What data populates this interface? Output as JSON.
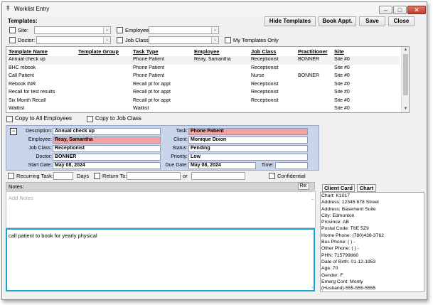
{
  "window": {
    "title": "Worklist Entry"
  },
  "toolbar": {
    "hide_templates": "Hide Templates",
    "book_appt": "Book Appt.",
    "save": "Save",
    "close": "Close"
  },
  "templates": {
    "heading": "Templates:",
    "site_label": "Site:",
    "employee_label": "Employee:",
    "doctor_label": "Doctor:",
    "jobclass_label": "Job Class:",
    "my_templates_only": "My Templates Only"
  },
  "grid": {
    "columns": [
      "Template Name",
      "Template Group",
      "Task Type",
      "Employee",
      "Job Class",
      "Practitioner",
      "Site"
    ],
    "rows": [
      [
        "Annual check up",
        "",
        "Phone Patient",
        "Reay, Samantha",
        "Receptionist",
        "BONNER",
        "Site #0"
      ],
      [
        "BHC rebook",
        "",
        "Phone Patient",
        "",
        "Receptionist",
        "",
        "Site #0"
      ],
      [
        "Call Patient",
        "",
        "Phone Patient",
        "",
        "Nurse",
        "BONNER",
        "Site #0"
      ],
      [
        "Rebook INR",
        "",
        "Recall pt for appt",
        "",
        "Receptionist",
        "",
        "Site #0"
      ],
      [
        "Recall for test results",
        "",
        "Recall pt for appt",
        "",
        "Receptionist",
        "",
        "Site #0"
      ],
      [
        "Six Month Recall",
        "",
        "Recall pt for appt",
        "",
        "Receptionist",
        "",
        "Site #0"
      ],
      [
        "Waitlist",
        "",
        "Waitlist",
        "",
        "",
        "",
        "Site #0"
      ]
    ]
  },
  "copy": {
    "all_employees": "Copy to All Employees",
    "job_class": "Copy to Job Class"
  },
  "detail": {
    "collapse": "−",
    "description_label": "Description:",
    "description": "Annual check up",
    "employee_label": "Employee:",
    "employee": "Reay, Samantha",
    "jobclass_label": "Job Class:",
    "jobclass": "Receptionist",
    "doctor_label": "Doctor:",
    "doctor": "BONNER",
    "startdate_label": "Start Date:",
    "startdate": "May 08, 2024",
    "task_label": "Task:",
    "task": "Phone Patient",
    "client_label": "Client:",
    "client": "Monique Dixon",
    "status_label": "Status:",
    "status": "Pending",
    "priority_label": "Priority:",
    "priority": "Low",
    "duedate_label": "Due Date:",
    "duedate": "May 08, 2024",
    "time_label": "Time:"
  },
  "recurring": {
    "recurring_label": "Recurring Task:",
    "days_label": "Days",
    "return_label": "Return To:",
    "or_label": "or",
    "confidential_label": "Confidential"
  },
  "notes": {
    "label": "Notes:",
    "re_label": "Re:",
    "placeholder": "Add Notes",
    "message": "call patient to book for yearly physical"
  },
  "tabs": {
    "client_card": "Client Card",
    "chart": "Chart"
  },
  "client_card": {
    "lines": [
      "Chart: K1017",
      "Address: 12345 678 Street",
      "Address: Basement Suite",
      "City: Edmonton",
      "Province: AB",
      "Postal Code: T6E 5Z9",
      "Home Phone: (780)438-3762",
      "Bus Phone: (  )  -",
      "Other Phone: (  )  -",
      "PHN: 715799860",
      "Date of Birth: 01-12-1953",
      "Age: 70",
      "Gender: F",
      "Emerg Cont: Monty",
      "(Husband)-555-555-5555"
    ]
  },
  "colors": {
    "detail_panel": "#c9d5eb",
    "highlight_pink": "#f4a3a3",
    "focus_border": "#1aa5d8"
  }
}
